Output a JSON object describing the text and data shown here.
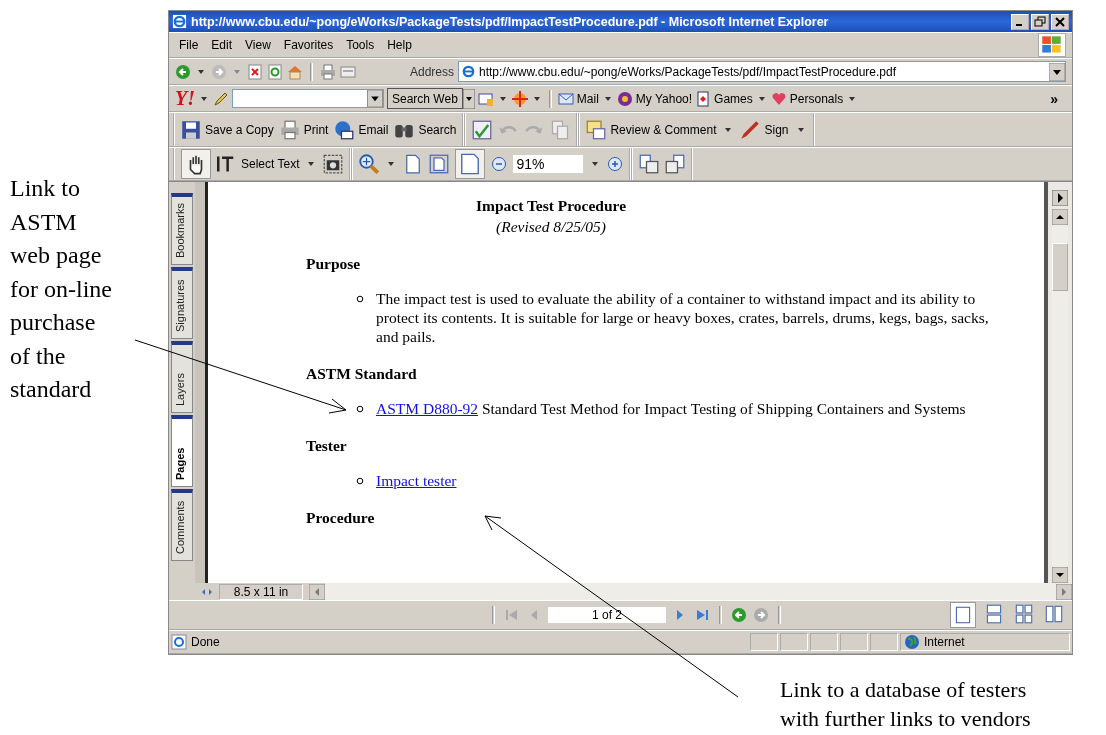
{
  "window": {
    "title": "http://www.cbu.edu/~pong/eWorks/PackageTests/pdf/ImpactTestProcedure.pdf - Microsoft Internet Explorer"
  },
  "menu": [
    "File",
    "Edit",
    "View",
    "Favorites",
    "Tools",
    "Help"
  ],
  "address": {
    "label": "Address",
    "value": "http://www.cbu.edu/~pong/eWorks/PackageTests/pdf/ImpactTestProcedure.pdf"
  },
  "yahoo_toolbar": {
    "logo": "Y!",
    "search_button": "Search Web",
    "items": [
      "Mail",
      "My Yahoo!",
      "Games",
      "Personals"
    ],
    "more": "»"
  },
  "acrobat_toolbar": {
    "buttons": [
      "Save a Copy",
      "Print",
      "Email",
      "Search"
    ],
    "review": "Review & Comment",
    "sign": "Sign"
  },
  "view_toolbar": {
    "select_text": "Select Text",
    "zoom": "91%"
  },
  "side_tabs": [
    {
      "label": "Bookmarks",
      "selected": false
    },
    {
      "label": "Signatures",
      "selected": false
    },
    {
      "label": "Layers",
      "selected": false
    },
    {
      "label": "Pages",
      "selected": true
    },
    {
      "label": "Comments",
      "selected": false
    }
  ],
  "document": {
    "title": "Impact Test Procedure",
    "subtitle": "(Revised 8/25/05)",
    "sections": [
      {
        "heading": "Purpose",
        "bullets": [
          {
            "text": "The impact test is used to evaluate the ability of a container to withstand impact and its ability to protect its contents.  It is suitable for large or heavy boxes, crates, barrels, drums, kegs, bags, sacks, and pails."
          }
        ]
      },
      {
        "heading": "ASTM Standard",
        "bullets": [
          {
            "link": "ASTM D880-92",
            "text": "Standard Test Method for Impact Testing of Shipping Containers and Systems"
          }
        ]
      },
      {
        "heading": "Tester",
        "bullets": [
          {
            "link": "Impact tester"
          }
        ]
      },
      {
        "heading": "Procedure"
      }
    ]
  },
  "page_size": "8.5 x 11 in",
  "page_nav": {
    "value": "1 of 2"
  },
  "view_modes": [
    {
      "kind": "single",
      "selected": true
    },
    {
      "kind": "continuous",
      "selected": false
    },
    {
      "kind": "facing",
      "selected": false
    },
    {
      "kind": "continuous-facing",
      "selected": false
    }
  ],
  "status_bar": {
    "text": "Done",
    "zone": "Internet"
  },
  "annotations": [
    {
      "lines": [
        "Link to",
        "ASTM",
        "web page",
        "for on-line",
        "purchase",
        "of the",
        "standard"
      ]
    },
    {
      "lines": [
        "Link to a database of testers",
        "with further links to vendors"
      ]
    }
  ]
}
